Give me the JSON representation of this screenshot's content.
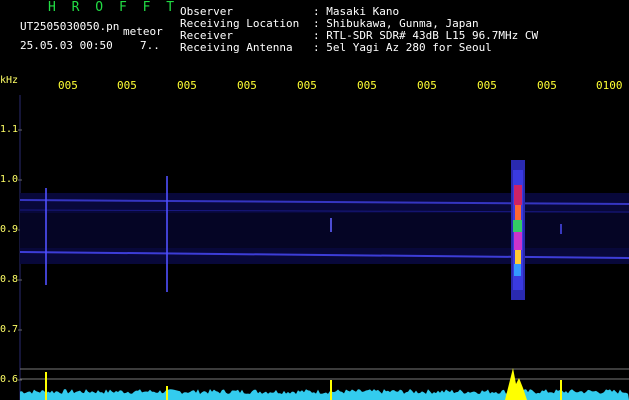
{
  "header": {
    "title": "H R O F F T",
    "filename": "UT2505030050.pn",
    "detection_type": "meteor",
    "datetime": "25.05.03 00:50",
    "extra": "7.."
  },
  "meta": [
    {
      "label": "Observer",
      "value": ": Masaki Kano"
    },
    {
      "label": "Receiving Location",
      "value": ": Shibukawa, Gunma, Japan"
    },
    {
      "label": "Receiver",
      "value": ": RTL-SDR SDR# 43dB L15 96.7MHz CW"
    },
    {
      "label": "Receiving Antenna",
      "value": ": 5el Yagi Az 280 for Seoul"
    }
  ],
  "axis": {
    "y_unit": "kHz",
    "y_ticks": [
      "1.1",
      "1.0",
      "0.9",
      "0.8",
      "0.7",
      "0.6"
    ],
    "x_ticks": [
      "005",
      "005",
      "005",
      "005",
      "005",
      "005",
      "005",
      "005",
      "0100"
    ]
  },
  "colors": {
    "background": "#000000",
    "label_yellow": "#ffff33",
    "title_green": "#22dd44",
    "text_white": "#ffffff",
    "signal_blue": "#2a2aa0",
    "power_cyan": "#33ccee",
    "power_peak": "#ffff00"
  }
}
